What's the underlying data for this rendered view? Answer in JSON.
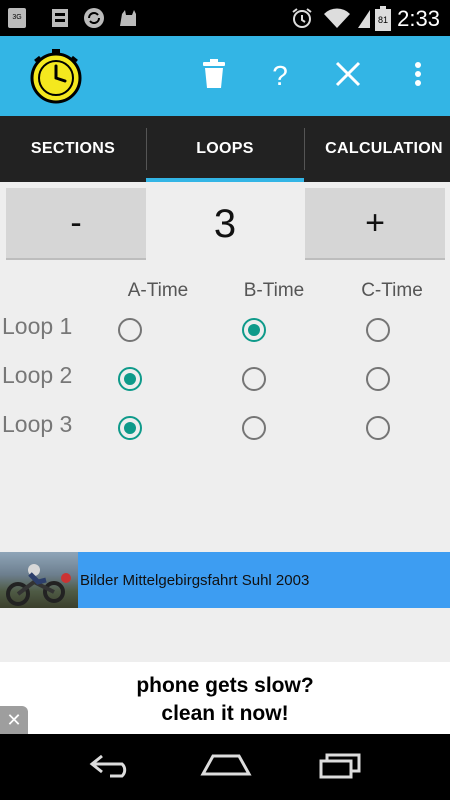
{
  "status_bar": {
    "time": "2:33",
    "battery_level": "81",
    "network_label": "3G"
  },
  "action_bar": {
    "icons": {
      "app": "stopwatch-icon",
      "delete": "trash-icon",
      "help": "?",
      "close": "close-icon",
      "overflow": "more-vert-icon"
    },
    "colors": {
      "background": "#33b5e5",
      "app_icon_fill": "#f4e81e"
    }
  },
  "tabs": [
    {
      "label": "SECTIONS"
    },
    {
      "label": "LOOPS"
    },
    {
      "label": "CALCULATION"
    }
  ],
  "counter": {
    "minus_label": "-",
    "value": "3",
    "plus_label": "+"
  },
  "loops_grid": {
    "columns": [
      "A-Time",
      "B-Time",
      "C-Time"
    ],
    "rows": [
      {
        "label": "Loop 1",
        "selected": 1
      },
      {
        "label": "Loop 2",
        "selected": 0
      },
      {
        "label": "Loop 3",
        "selected": 0
      }
    ],
    "accent_color": "#0e9a8a"
  },
  "banner": {
    "text": "Bilder Mittelgebirgsfahrt Suhl 2003",
    "color": "#3d9df2"
  },
  "ad": {
    "line1": "phone gets slow?",
    "line2": "clean it now!",
    "close_label": "✕"
  }
}
